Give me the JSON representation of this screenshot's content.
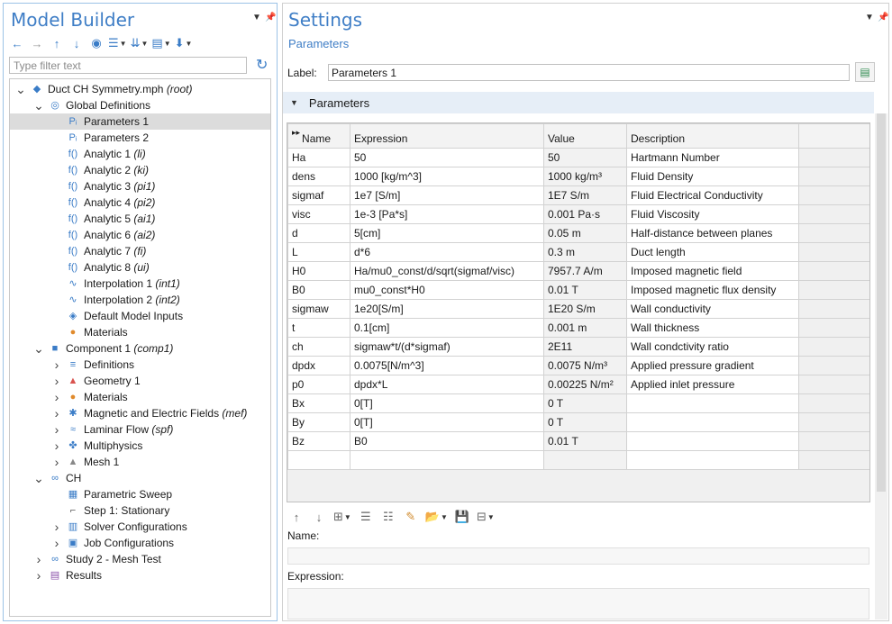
{
  "model_builder": {
    "title": "Model Builder",
    "filter_placeholder": "Type filter text",
    "tree": [
      {
        "indent": 0,
        "arrow": "v",
        "icon": "root-icon",
        "glyph": "◆",
        "color": "#3a7cc7",
        "text": "Duct CH Symmetry.mph",
        "suffix": "(root)"
      },
      {
        "indent": 1,
        "arrow": "v",
        "icon": "globe-icon",
        "glyph": "◎",
        "color": "#3a7cc7",
        "text": "Global Definitions",
        "suffix": ""
      },
      {
        "indent": 2,
        "arrow": "",
        "icon": "parameters-icon",
        "glyph": "Pᵢ",
        "color": "#3a7cc7",
        "text": "Parameters 1",
        "suffix": "",
        "selected": true
      },
      {
        "indent": 2,
        "arrow": "",
        "icon": "parameters-icon",
        "glyph": "Pᵢ",
        "color": "#3a7cc7",
        "text": "Parameters 2",
        "suffix": ""
      },
      {
        "indent": 2,
        "arrow": "",
        "icon": "function-icon",
        "glyph": "f()",
        "color": "#3a7cc7",
        "text": "Analytic 1",
        "suffix": "(li)"
      },
      {
        "indent": 2,
        "arrow": "",
        "icon": "function-icon",
        "glyph": "f()",
        "color": "#3a7cc7",
        "text": "Analytic 2",
        "suffix": "(ki)"
      },
      {
        "indent": 2,
        "arrow": "",
        "icon": "function-icon",
        "glyph": "f()",
        "color": "#3a7cc7",
        "text": "Analytic 3",
        "suffix": "(pi1)"
      },
      {
        "indent": 2,
        "arrow": "",
        "icon": "function-icon",
        "glyph": "f()",
        "color": "#3a7cc7",
        "text": "Analytic 4",
        "suffix": "(pi2)"
      },
      {
        "indent": 2,
        "arrow": "",
        "icon": "function-icon",
        "glyph": "f()",
        "color": "#3a7cc7",
        "text": "Analytic 5",
        "suffix": "(ai1)"
      },
      {
        "indent": 2,
        "arrow": "",
        "icon": "function-icon",
        "glyph": "f()",
        "color": "#3a7cc7",
        "text": "Analytic 6",
        "suffix": "(ai2)"
      },
      {
        "indent": 2,
        "arrow": "",
        "icon": "function-icon",
        "glyph": "f()",
        "color": "#3a7cc7",
        "text": "Analytic 7",
        "suffix": "(fi)"
      },
      {
        "indent": 2,
        "arrow": "",
        "icon": "function-icon",
        "glyph": "f()",
        "color": "#3a7cc7",
        "text": "Analytic 8",
        "suffix": "(ui)"
      },
      {
        "indent": 2,
        "arrow": "",
        "icon": "interpolation-icon",
        "glyph": "∿",
        "color": "#3a7cc7",
        "text": "Interpolation 1",
        "suffix": "(int1)"
      },
      {
        "indent": 2,
        "arrow": "",
        "icon": "interpolation-icon",
        "glyph": "∿",
        "color": "#3a7cc7",
        "text": "Interpolation 2",
        "suffix": "(int2)"
      },
      {
        "indent": 2,
        "arrow": "",
        "icon": "default-inputs-icon",
        "glyph": "◈",
        "color": "#3a7cc7",
        "text": "Default Model Inputs",
        "suffix": ""
      },
      {
        "indent": 2,
        "arrow": "",
        "icon": "materials-icon",
        "glyph": "●",
        "color": "#e08a2c",
        "text": "Materials",
        "suffix": ""
      },
      {
        "indent": 1,
        "arrow": "v",
        "icon": "component-icon",
        "glyph": "■",
        "color": "#3a7cc7",
        "text": "Component 1",
        "suffix": "(comp1)"
      },
      {
        "indent": 2,
        "arrow": ">",
        "icon": "definitions-icon",
        "glyph": "≡",
        "color": "#3a7cc7",
        "text": "Definitions",
        "suffix": ""
      },
      {
        "indent": 2,
        "arrow": ">",
        "icon": "geometry-icon",
        "glyph": "▲",
        "color": "#d9534f",
        "text": "Geometry 1",
        "suffix": ""
      },
      {
        "indent": 2,
        "arrow": ">",
        "icon": "materials-icon",
        "glyph": "●",
        "color": "#e08a2c",
        "text": "Materials",
        "suffix": ""
      },
      {
        "indent": 2,
        "arrow": ">",
        "icon": "physics-icon",
        "glyph": "✱",
        "color": "#3a7cc7",
        "text": "Magnetic and Electric Fields",
        "suffix": "(mef)"
      },
      {
        "indent": 2,
        "arrow": ">",
        "icon": "flow-icon",
        "glyph": "≈",
        "color": "#3a7cc7",
        "text": "Laminar Flow",
        "suffix": "(spf)"
      },
      {
        "indent": 2,
        "arrow": ">",
        "icon": "multiphysics-icon",
        "glyph": "✤",
        "color": "#3a7cc7",
        "text": "Multiphysics",
        "suffix": ""
      },
      {
        "indent": 2,
        "arrow": ">",
        "icon": "mesh-icon",
        "glyph": "▲",
        "color": "#888888",
        "text": "Mesh 1",
        "suffix": ""
      },
      {
        "indent": 1,
        "arrow": "v",
        "icon": "study-icon",
        "glyph": "∞",
        "color": "#3a7cc7",
        "text": "CH",
        "suffix": ""
      },
      {
        "indent": 2,
        "arrow": "",
        "icon": "sweep-icon",
        "glyph": "▦",
        "color": "#3a7cc7",
        "text": "Parametric Sweep",
        "suffix": ""
      },
      {
        "indent": 2,
        "arrow": "",
        "icon": "step-icon",
        "glyph": "⌐",
        "color": "#555555",
        "text": "Step 1: Stationary",
        "suffix": ""
      },
      {
        "indent": 2,
        "arrow": ">",
        "icon": "solver-icon",
        "glyph": "▥",
        "color": "#3a7cc7",
        "text": "Solver Configurations",
        "suffix": ""
      },
      {
        "indent": 2,
        "arrow": ">",
        "icon": "job-icon",
        "glyph": "▣",
        "color": "#3a7cc7",
        "text": "Job Configurations",
        "suffix": ""
      },
      {
        "indent": 1,
        "arrow": ">",
        "icon": "study-icon",
        "glyph": "∞",
        "color": "#3a7cc7",
        "text": "Study 2 - Mesh Test",
        "suffix": ""
      },
      {
        "indent": 1,
        "arrow": ">",
        "icon": "results-icon",
        "glyph": "▤",
        "color": "#8a4fa8",
        "text": "Results",
        "suffix": ""
      }
    ]
  },
  "settings": {
    "title": "Settings",
    "subtitle": "Parameters",
    "label_caption": "Label:",
    "label_value": "Parameters 1",
    "section": "Parameters",
    "columns": [
      "Name",
      "Expression",
      "Value",
      "Description"
    ],
    "rows": [
      {
        "name": "Ha",
        "expr": "50",
        "value": "50",
        "desc": "Hartmann Number"
      },
      {
        "name": "dens",
        "expr": "1000 [kg/m^3]",
        "value": "1000 kg/m³",
        "desc": "Fluid Density"
      },
      {
        "name": "sigmaf",
        "expr": "1e7 [S/m]",
        "value": "1E7 S/m",
        "desc": "Fluid Electrical Conductivity"
      },
      {
        "name": "visc",
        "expr": "1e-3 [Pa*s]",
        "value": "0.001 Pa·s",
        "desc": "Fluid Viscosity"
      },
      {
        "name": "d",
        "expr": "5[cm]",
        "value": "0.05 m",
        "desc": "Half-distance between planes"
      },
      {
        "name": "L",
        "expr": "d*6",
        "value": "0.3 m",
        "desc": "Duct length"
      },
      {
        "name": "H0",
        "expr": "Ha/mu0_const/d/sqrt(sigmaf/visc)",
        "value": "7957.7 A/m",
        "desc": "Imposed magnetic field"
      },
      {
        "name": "B0",
        "expr": "mu0_const*H0",
        "value": "0.01 T",
        "desc": "Imposed magnetic flux density"
      },
      {
        "name": "sigmaw",
        "expr": "1e20[S/m]",
        "value": "1E20 S/m",
        "desc": "Wall conductivity"
      },
      {
        "name": "t",
        "expr": "0.1[cm]",
        "value": "0.001 m",
        "desc": "Wall thickness"
      },
      {
        "name": "ch",
        "expr": "sigmaw*t/(d*sigmaf)",
        "value": "2E11",
        "desc": "Wall condctivity ratio"
      },
      {
        "name": "dpdx",
        "expr": "0.0075[N/m^3]",
        "value": "0.0075 N/m³",
        "desc": "Applied pressure gradient"
      },
      {
        "name": "p0",
        "expr": "dpdx*L",
        "value": "0.00225 N/m²",
        "desc": "Applied inlet pressure"
      },
      {
        "name": "Bx",
        "expr": "0[T]",
        "value": "0 T",
        "desc": ""
      },
      {
        "name": "By",
        "expr": "0[T]",
        "value": "0 T",
        "desc": ""
      },
      {
        "name": "Bz",
        "expr": "B0",
        "value": "0.01 T",
        "desc": ""
      },
      {
        "name": "",
        "expr": "",
        "value": "",
        "desc": ""
      }
    ],
    "name_caption": "Name:",
    "expression_caption": "Expression:"
  },
  "colors": {
    "accent": "#3f7ec6",
    "selection": "#dcdcdc",
    "section_bg": "#e6eef7"
  }
}
